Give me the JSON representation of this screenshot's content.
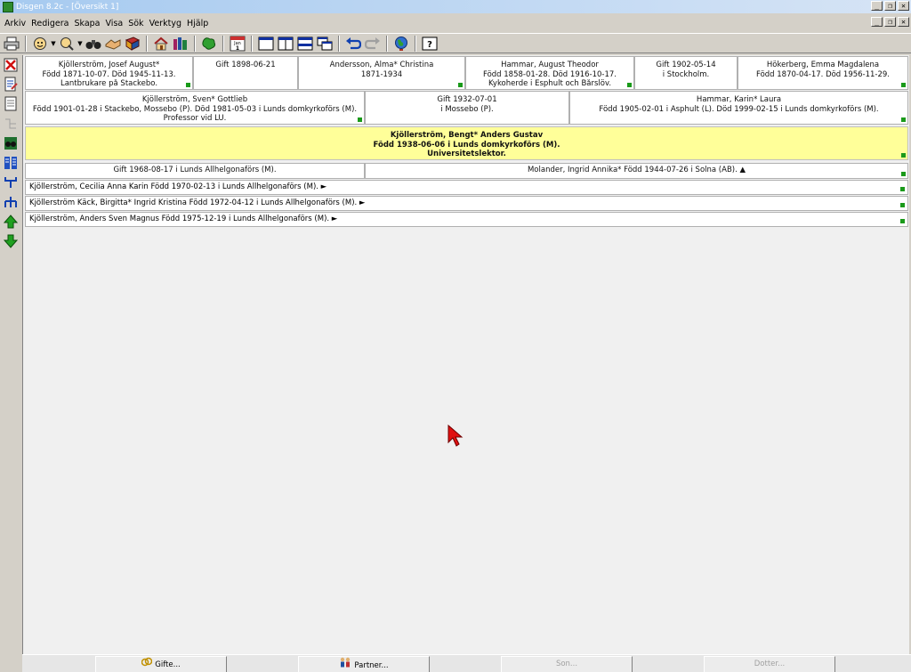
{
  "window": {
    "title": "Disgen 8.2c - [Översikt 1]",
    "controls": [
      "_",
      "❐",
      "✕"
    ]
  },
  "menu": [
    "Arkiv",
    "Redigera",
    "Skapa",
    "Visa",
    "Sök",
    "Verktyg",
    "Hjälp"
  ],
  "toolbar_icons": [
    "print-icon",
    "person-icon",
    "find-person-icon",
    "binoculars-icon",
    "handshake-icon",
    "book-icon",
    "home-icon",
    "books-icon",
    "map-icon",
    "calendar-icon",
    "layout-single-icon",
    "layout-split-icon",
    "layout-rows-icon",
    "layout-cascade-icon",
    "undo-icon",
    "redo-icon",
    "globe-icon",
    "help-icon"
  ],
  "calendar_label": "Jan 1",
  "help_label": "?",
  "grandparents": [
    {
      "lines": [
        "Kjöllerström, Josef August*",
        "Född 1871-10-07. Död 1945-11-13.",
        "Lantbrukare på Stackebo."
      ],
      "marker": true
    },
    {
      "lines": [
        "Gift 1898-06-21"
      ],
      "marker": false
    },
    {
      "lines": [
        "Andersson, Alma* Christina",
        "1871-1934"
      ],
      "marker": true
    },
    {
      "lines": [
        "Hammar, August Theodor",
        "Född 1858-01-28. Död 1916-10-17.",
        "Kykoherde i Esphult och Bårslöv."
      ],
      "marker": true
    },
    {
      "lines": [
        "Gift 1902-05-14",
        "i Stockholm."
      ],
      "marker": false
    },
    {
      "lines": [
        "Hökerberg, Emma Magdalena",
        "Född 1870-04-17. Död 1956-11-29."
      ],
      "marker": true
    }
  ],
  "parents": [
    {
      "lines": [
        "Kjöllerström, Sven* Gottlieb",
        "Född 1901-01-28 i Stackebo, Mossebo (P). Död 1981-05-03 i Lunds domkyrkoförs (M).",
        "Professor vid LU."
      ],
      "marker": true
    },
    {
      "lines": [
        "Gift 1932-07-01",
        "i Mossebo (P)."
      ],
      "marker": false
    },
    {
      "lines": [
        "Hammar, Karin* Laura",
        "Född 1905-02-01 i Äsphult (L). Död 1999-02-15 i Lunds domkyrkoförs (M)."
      ],
      "marker": true
    }
  ],
  "main_person": {
    "lines": [
      "Kjöllerström, Bengt* Anders Gustav",
      "Född 1938-06-06 i Lunds domkyrkoförs (M).",
      "Universitetslektor."
    ]
  },
  "marriage": {
    "left": "Gift 1968-08-17 i Lunds Allhelgonaförs (M).",
    "right": "Molander, Ingrid Annika* Född 1944-07-26 i Solna (AB). ▲"
  },
  "children": [
    "Kjöllerström, Cecilia Anna Karin Född 1970-02-13 i Lunds Allhelgonaförs (M). ►",
    "Kjöllerström Käck, Birgitta* Ingrid Kristina Född 1972-04-12 i Lunds Allhelgonaförs (M). ►",
    "Kjöllerström, Anders Sven Magnus Född 1975-12-19 i Lunds Allhelgonaförs (M). ►"
  ],
  "bottom_buttons": [
    {
      "label": "Gifte...",
      "icon": "rings-icon",
      "enabled": true
    },
    {
      "label": "Partner...",
      "icon": "couple-icon",
      "enabled": true
    },
    {
      "label": "Son...",
      "icon": "",
      "enabled": false
    },
    {
      "label": "Dotter...",
      "icon": "",
      "enabled": false
    }
  ],
  "colors": {
    "main_person_bg": "#ffff99",
    "marker": "#1a9a1a",
    "cursor": "#e01010"
  }
}
